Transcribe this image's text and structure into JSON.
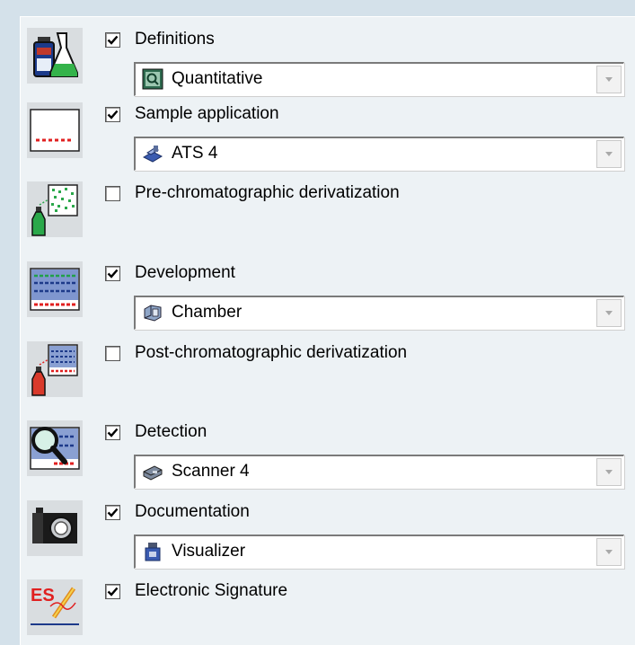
{
  "steps": [
    {
      "label": "Definitions",
      "checked": true,
      "icon": "flasks-icon",
      "dropdown": {
        "value": "Quantitative",
        "icon": "quantitative-icon"
      }
    },
    {
      "label": "Sample application",
      "checked": true,
      "icon": "sample-plate-icon",
      "dropdown": {
        "value": "ATS 4",
        "icon": "ats-instrument-icon"
      }
    },
    {
      "label": "Pre-chromatographic derivatization",
      "checked": false,
      "icon": "pre-derivatization-icon"
    },
    {
      "label": "Development",
      "checked": true,
      "icon": "development-plate-icon",
      "dropdown": {
        "value": "Chamber",
        "icon": "chamber-icon"
      }
    },
    {
      "label": "Post-chromatographic derivatization",
      "checked": false,
      "icon": "post-derivatization-icon"
    },
    {
      "label": "Detection",
      "checked": true,
      "icon": "detection-magnifier-icon",
      "dropdown": {
        "value": "Scanner 4",
        "icon": "scanner-icon"
      }
    },
    {
      "label": "Documentation",
      "checked": true,
      "icon": "camera-icon",
      "dropdown": {
        "value": "Visualizer",
        "icon": "visualizer-icon"
      }
    },
    {
      "label": "Electronic Signature",
      "checked": true,
      "icon": "electronic-signature-icon"
    }
  ],
  "colors": {
    "panel": "#edf2f5",
    "background": "#d4e1ea",
    "icon_tile": "#d9dde0"
  }
}
